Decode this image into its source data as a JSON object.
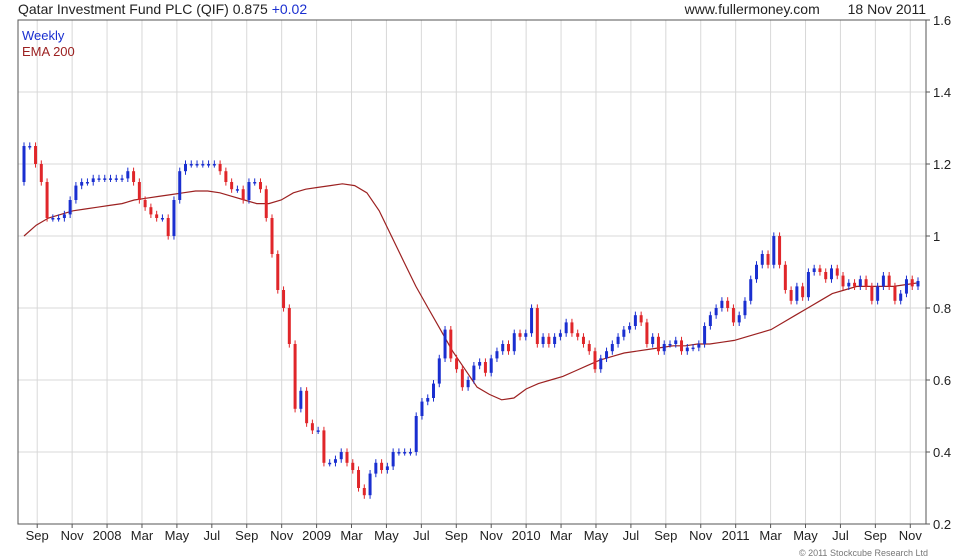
{
  "header": {
    "title": "Qatar Investment Fund PLC (QIF)",
    "price": "0.875",
    "change": "+0.02",
    "site": "www.fullermoney.com",
    "date": "18 Nov 2011"
  },
  "legend": {
    "series1": "Weekly",
    "series2": "EMA 200"
  },
  "copyright": "© 2011 Stockcube Research Ltd",
  "colors": {
    "up": "#1a2fd0",
    "down": "#e0262a",
    "ema": "#9c2121",
    "grid": "#d8d8d8",
    "frame": "#555555"
  },
  "chart_data": {
    "type": "candlestick",
    "ylim": [
      0.2,
      1.6
    ],
    "yticks": [
      0.2,
      0.4,
      0.6,
      0.8,
      1,
      1.2,
      1.4,
      1.6
    ],
    "xlabels": [
      "Sep",
      "Nov",
      "2008",
      "Mar",
      "May",
      "Jul",
      "Sep",
      "Nov",
      "2009",
      "Mar",
      "May",
      "Jul",
      "Sep",
      "Nov",
      "2010",
      "Mar",
      "May",
      "Jul",
      "Sep",
      "Nov",
      "2011",
      "Mar",
      "May",
      "Jul",
      "Sep",
      "Nov"
    ],
    "series": [
      {
        "name": "Weekly",
        "type": "candlestick",
        "close": [
          1.25,
          1.25,
          1.2,
          1.15,
          1.05,
          1.05,
          1.05,
          1.06,
          1.1,
          1.14,
          1.15,
          1.15,
          1.16,
          1.16,
          1.16,
          1.16,
          1.16,
          1.16,
          1.18,
          1.15,
          1.1,
          1.08,
          1.06,
          1.05,
          1.05,
          1.0,
          1.1,
          1.18,
          1.2,
          1.2,
          1.2,
          1.2,
          1.2,
          1.2,
          1.18,
          1.15,
          1.13,
          1.13,
          1.1,
          1.15,
          1.15,
          1.13,
          1.05,
          0.95,
          0.85,
          0.8,
          0.7,
          0.52,
          0.57,
          0.48,
          0.46,
          0.46,
          0.37,
          0.37,
          0.38,
          0.4,
          0.37,
          0.35,
          0.3,
          0.28,
          0.34,
          0.37,
          0.35,
          0.36,
          0.4,
          0.4,
          0.4,
          0.4,
          0.5,
          0.54,
          0.55,
          0.59,
          0.66,
          0.74,
          0.66,
          0.63,
          0.58,
          0.6,
          0.64,
          0.65,
          0.62,
          0.66,
          0.68,
          0.7,
          0.68,
          0.73,
          0.72,
          0.73,
          0.8,
          0.7,
          0.72,
          0.7,
          0.72,
          0.73,
          0.76,
          0.73,
          0.72,
          0.7,
          0.68,
          0.63,
          0.66,
          0.68,
          0.7,
          0.72,
          0.74,
          0.75,
          0.78,
          0.76,
          0.7,
          0.72,
          0.68,
          0.7,
          0.7,
          0.71,
          0.68,
          0.69,
          0.69,
          0.7,
          0.75,
          0.78,
          0.8,
          0.82,
          0.8,
          0.76,
          0.78,
          0.82,
          0.88,
          0.92,
          0.95,
          0.92,
          1.0,
          0.92,
          0.85,
          0.82,
          0.86,
          0.83,
          0.9,
          0.91,
          0.9,
          0.88,
          0.91,
          0.89,
          0.86,
          0.87,
          0.86,
          0.88,
          0.86,
          0.82,
          0.86,
          0.89,
          0.86,
          0.82,
          0.84,
          0.88,
          0.86,
          0.875
        ],
        "ema200": [
          1.0,
          1.03,
          1.05,
          1.06,
          1.07,
          1.075,
          1.08,
          1.085,
          1.09,
          1.1,
          1.105,
          1.11,
          1.115,
          1.12,
          1.125,
          1.125,
          1.12,
          1.11,
          1.1,
          1.09,
          1.09,
          1.1,
          1.12,
          1.13,
          1.135,
          1.14,
          1.145,
          1.14,
          1.12,
          1.07,
          1.0,
          0.93,
          0.86,
          0.8,
          0.74,
          0.68,
          0.63,
          0.58,
          0.56,
          0.545,
          0.55,
          0.575,
          0.59,
          0.6,
          0.61,
          0.625,
          0.64,
          0.655,
          0.665,
          0.675,
          0.68,
          0.685,
          0.69,
          0.695,
          0.695,
          0.7,
          0.7,
          0.705,
          0.71,
          0.72,
          0.73,
          0.74,
          0.76,
          0.78,
          0.8,
          0.82,
          0.84,
          0.85,
          0.86,
          0.86,
          0.86,
          0.86,
          0.865,
          0.87
        ]
      }
    ]
  }
}
